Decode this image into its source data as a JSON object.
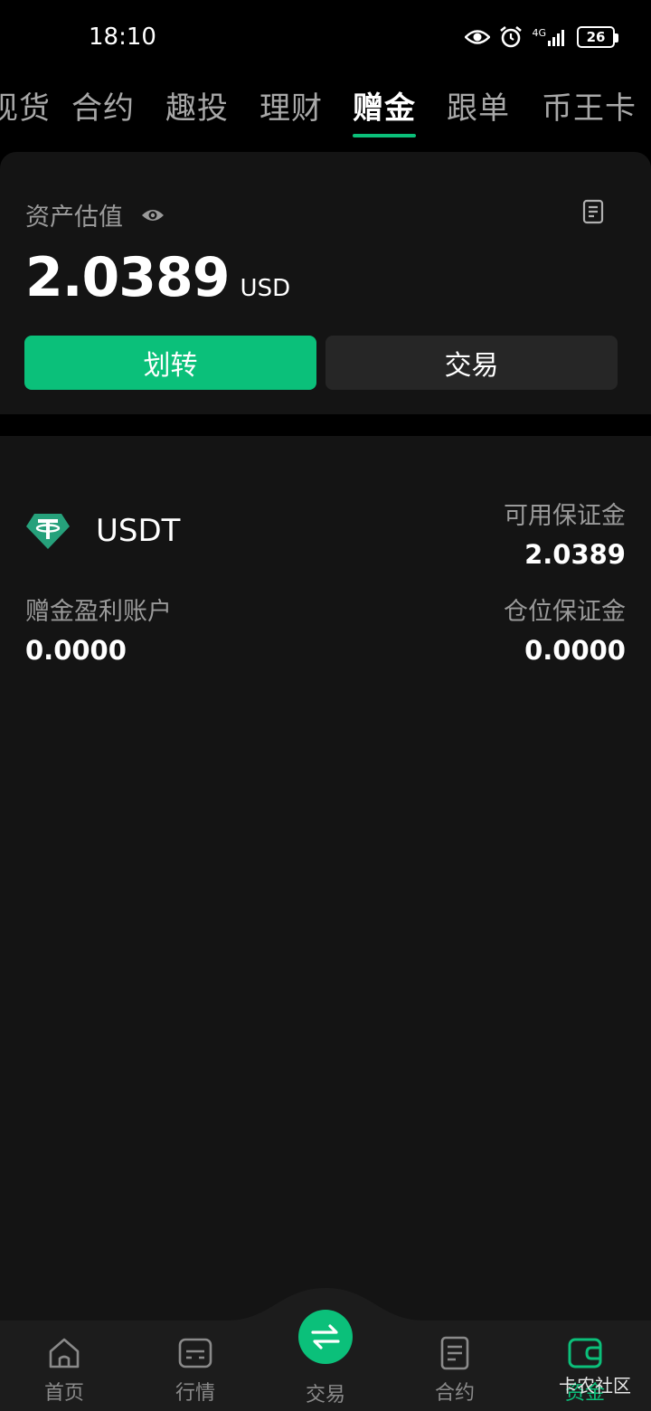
{
  "status_bar": {
    "time": "18:10",
    "network": "4G",
    "battery": "26",
    "icons": [
      "eye-icon",
      "alarm-icon",
      "signal-icon",
      "battery-icon"
    ]
  },
  "tabs": [
    {
      "label": "现货",
      "active": false
    },
    {
      "label": "合约",
      "active": false
    },
    {
      "label": "趣投",
      "active": false
    },
    {
      "label": "理财",
      "active": false
    },
    {
      "label": "赠金",
      "active": true
    },
    {
      "label": "跟单",
      "active": false
    },
    {
      "label": "币王卡",
      "active": false
    }
  ],
  "asset": {
    "label": "资产估值",
    "value": "2.0389",
    "unit": "USD",
    "transfer_label": "划转",
    "trade_label": "交易"
  },
  "account": {
    "coin": "USDT",
    "available_margin_label": "可用保证金",
    "available_margin_value": "2.0389",
    "bonus_profit_label": "赠金盈利账户",
    "bonus_profit_value": "0.0000",
    "position_margin_label": "仓位保证金",
    "position_margin_value": "0.0000"
  },
  "bottom_nav": [
    {
      "label": "首页",
      "icon": "home-icon",
      "active": false
    },
    {
      "label": "行情",
      "icon": "market-icon",
      "active": false
    },
    {
      "label": "交易",
      "icon": "trade-swap-icon",
      "active": false
    },
    {
      "label": "合约",
      "icon": "contract-icon",
      "active": false
    },
    {
      "label": "资金",
      "icon": "wallet-icon",
      "active": true
    }
  ],
  "watermark": "卡农社区",
  "colors": {
    "accent": "#0bc07a",
    "background": "#000000",
    "card": "#141414",
    "usdt": "#26a17b"
  }
}
